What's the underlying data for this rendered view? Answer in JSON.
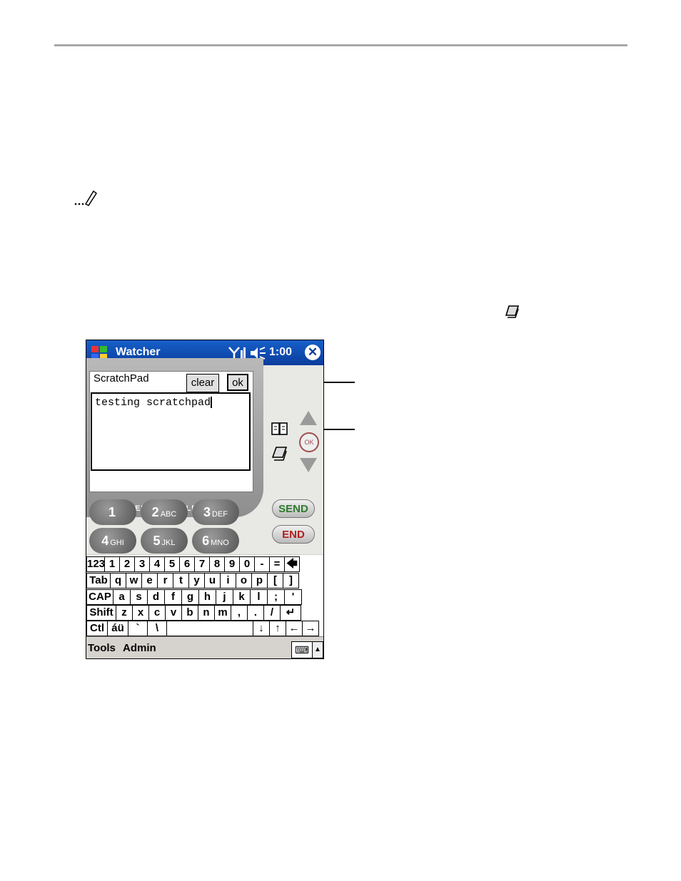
{
  "titlebar": {
    "app_name": "Watcher",
    "time": "1:00",
    "close_label": "✕"
  },
  "scratchpad": {
    "title": "ScratchPad",
    "clear_label": "clear",
    "ok_label": "ok",
    "text": "testing scratchpad"
  },
  "brand": "BIERRA WIRELESS",
  "side_controls": {
    "ok_round": "OK"
  },
  "keypad": [
    {
      "digit": "1",
      "letters": ""
    },
    {
      "digit": "2",
      "letters": "ABC"
    },
    {
      "digit": "3",
      "letters": "DEF"
    },
    {
      "digit": "4",
      "letters": "GHI"
    },
    {
      "digit": "5",
      "letters": "JKL"
    },
    {
      "digit": "6",
      "letters": "MNO"
    }
  ],
  "call_buttons": {
    "send": "SEND",
    "end": "END"
  },
  "keyboard": {
    "row1": [
      "123",
      "1",
      "2",
      "3",
      "4",
      "5",
      "6",
      "7",
      "8",
      "9",
      "0",
      "-",
      "=",
      "🡄"
    ],
    "row2": [
      "Tab",
      "q",
      "w",
      "e",
      "r",
      "t",
      "y",
      "u",
      "i",
      "o",
      "p",
      "[",
      "]"
    ],
    "row3": [
      "CAP",
      "a",
      "s",
      "d",
      "f",
      "g",
      "h",
      "j",
      "k",
      "l",
      ";",
      "'"
    ],
    "row4": [
      "Shift",
      "z",
      "x",
      "c",
      "v",
      "b",
      "n",
      "m",
      ",",
      ".",
      "/",
      "↵"
    ],
    "row5": [
      "Ctl",
      "áü",
      "`",
      "\\",
      "",
      "↓",
      "↑",
      "←",
      "→"
    ]
  },
  "menubar": {
    "tools": "Tools",
    "admin": "Admin"
  },
  "colors": {
    "titlebar": "#0b3c9c",
    "send": "#2d7a2d",
    "end": "#b02020"
  }
}
